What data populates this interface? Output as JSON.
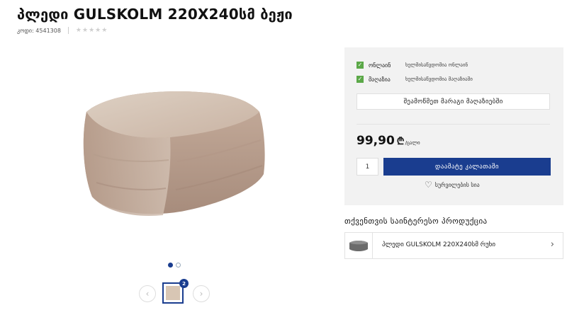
{
  "product": {
    "title": "პლედი GULSKOLM 220X240სმ ბეჟი",
    "code": "კოდი: 4541308",
    "rating_stars": 0,
    "star_glyph": "★"
  },
  "gallery": {
    "image_count_badge": "2",
    "prev_icon": "‹",
    "next_icon": "›"
  },
  "availability": [
    {
      "label": "ონლაინ",
      "status": "ხელმისაწვდომია ონლაინ"
    },
    {
      "label": "მაღაზია",
      "status": "ხელმისაწვდომია მაღაზიაში"
    }
  ],
  "check_glyph": "✓",
  "check_stores_label": "შეამოწმეთ მარაგი მაღაზიებში",
  "price": {
    "value": "99,90",
    "currency": "₾",
    "unit": "/ცალი"
  },
  "cart": {
    "quantity": "1",
    "add_label": "დაამატე კალათაში"
  },
  "wishlist": {
    "label": "სურვილების სია",
    "icon": "♡"
  },
  "recommendations": {
    "title": "თქვენთვის საინტერესო პროდუქცია",
    "items": [
      {
        "name": "პლედი GULSKOLM 220X240სმ რუხი",
        "chevron": "›"
      }
    ]
  },
  "colors": {
    "accent": "#1a3d8f",
    "check_green": "#5ba848",
    "panel_bg": "#f2f2f2"
  }
}
